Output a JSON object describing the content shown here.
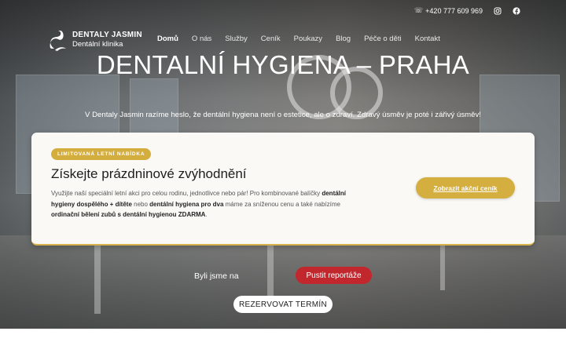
{
  "topbar": {
    "phone": "+420 777 609 969",
    "phone_icon": "phone-icon",
    "instagram_icon": "instagram-icon",
    "facebook_icon": "facebook-icon"
  },
  "logo": {
    "line1": "DENTALY JASMIN",
    "line2": "Dentální klinika",
    "icon": "swan-logo"
  },
  "nav": {
    "items": [
      "Domů",
      "O nás",
      "Služby",
      "Ceník",
      "Poukazy",
      "Blog",
      "Péče o děti",
      "Kontakt"
    ],
    "active": "Domů"
  },
  "hero": {
    "title": "DENTALNÍ HYGIENA – PRAHA",
    "subtitle": "V Dentaly Jasmin razíme heslo, že dentální hygiena není o estetice, ale o zdraví. Zdravý úsměv je poté i zářivý úsměv!"
  },
  "promo": {
    "badge": "LIMITOVANÁ LETNÍ NABÍDKA",
    "title": "Získejte prázdninové zvýhodnění",
    "text1": "Využijte naší speciální letní akci pro celou rodinu, jednotlivce nebo pár! Pro kombinované balíčky ",
    "bold1": "dentální hygieny dospělého + dítěte",
    "text2": " nebo ",
    "bold2": "dentální hygiena pro dva",
    "text3": " máme za sníženou cenu a také nabízíme ",
    "bold3": "ordinační bělení zubů s dentální hygienou ZDARMA",
    "text4": ".",
    "cta": "Zobrazit akční ceník"
  },
  "media": {
    "seen_label": "Byli jsme na",
    "report_button": "Pustit reportáže"
  },
  "booking": {
    "button": "REZERVOVAT TERMÍN"
  },
  "colors": {
    "accent": "#d4ae3f",
    "report": "#c1272d"
  }
}
